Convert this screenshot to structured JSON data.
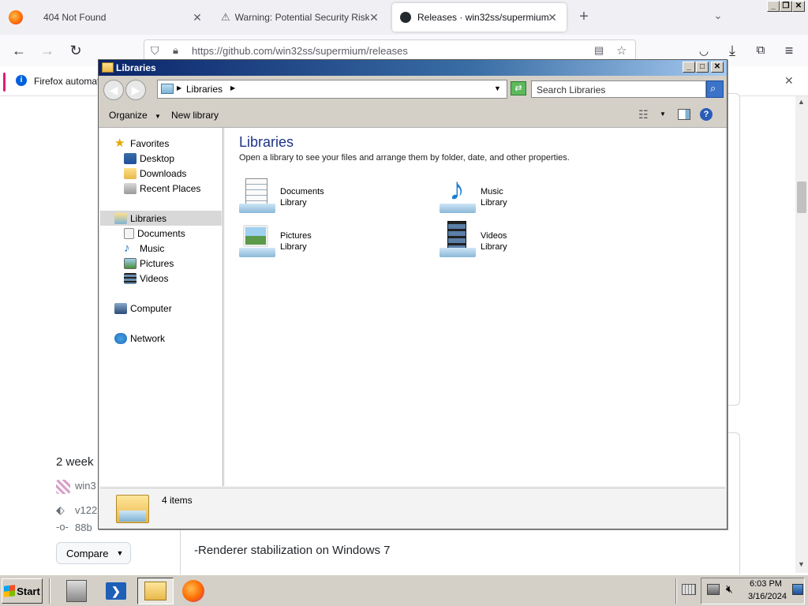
{
  "browser": {
    "tabs": [
      {
        "label": "404 Not Found",
        "active": false
      },
      {
        "label": "Warning: Potential Security Risk Ah",
        "active": false
      },
      {
        "label": "Releases · win32ss/supermium",
        "active": true
      }
    ],
    "url": "https://github.com/win32ss/supermium/releases",
    "notice": "Firefox automati"
  },
  "page_behind": {
    "fragment_weeks": "2 week",
    "fragment_user": "win3",
    "fragment_tag": "v122",
    "fragment_commit": "88b",
    "compare_button": "Compare",
    "release_note": "-Renderer stabilization on Windows 7"
  },
  "explorer": {
    "title": "Libraries",
    "address": "Libraries",
    "search_placeholder": "Search Libraries",
    "commands": {
      "organize": "Organize",
      "new_library": "New library"
    },
    "nav": {
      "favorites": {
        "label": "Favorites",
        "items": [
          "Desktop",
          "Downloads",
          "Recent Places"
        ]
      },
      "libraries": {
        "label": "Libraries",
        "items": [
          "Documents",
          "Music",
          "Pictures",
          "Videos"
        ]
      },
      "computer": "Computer",
      "network": "Network"
    },
    "content": {
      "heading": "Libraries",
      "subtitle": "Open a library to see your files and arrange them by folder, date, and other properties.",
      "libraries": [
        {
          "name": "Documents",
          "kind": "Library",
          "icon": "documents-library-icon"
        },
        {
          "name": "Music",
          "kind": "Library",
          "icon": "music-library-icon"
        },
        {
          "name": "Pictures",
          "kind": "Library",
          "icon": "pictures-library-icon"
        },
        {
          "name": "Videos",
          "kind": "Library",
          "icon": "videos-library-icon"
        }
      ]
    },
    "status": {
      "count": "4 items"
    }
  },
  "taskbar": {
    "start": "Start",
    "time": "6:03 PM",
    "date": "3/16/2024"
  },
  "colors": {
    "title_gradient_start": "#0a246a",
    "content_heading": "#1e3287",
    "taskbar": "#d4d0c8"
  }
}
